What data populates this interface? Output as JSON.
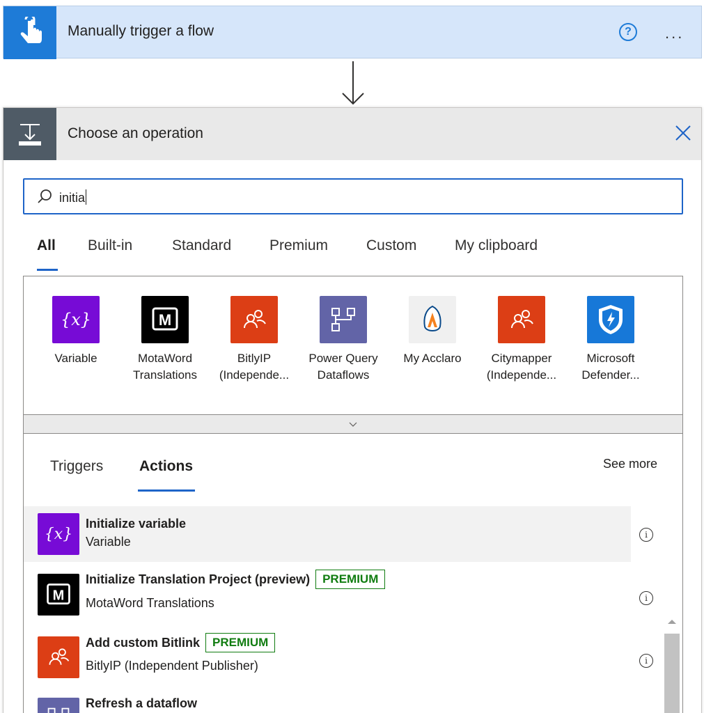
{
  "trigger": {
    "title": "Manually trigger a flow",
    "help_icon": "?",
    "more_icon": "..."
  },
  "panel": {
    "title": "Choose an operation"
  },
  "search": {
    "value": "initia"
  },
  "tabs": [
    "All",
    "Built-in",
    "Standard",
    "Premium",
    "Custom",
    "My clipboard"
  ],
  "connectors": [
    {
      "line1": "Variable",
      "line2": "",
      "icon": "variable-icon",
      "color": "#770bd6"
    },
    {
      "line1": "MotaWord",
      "line2": "Translations",
      "icon": "motaword-icon",
      "color": "#000000"
    },
    {
      "line1": "BitlyIP",
      "line2": "(Independe...",
      "icon": "bitlyip-icon",
      "color": "#dc3e15"
    },
    {
      "line1": "Power Query",
      "line2": "Dataflows",
      "icon": "dataflow-icon",
      "color": "#6264a7"
    },
    {
      "line1": "My Acclaro",
      "line2": "",
      "icon": "acclaro-icon",
      "color": "#f0f0f0"
    },
    {
      "line1": "Citymapper",
      "line2": "(Independe...",
      "icon": "citymapper-icon",
      "color": "#dc3e15"
    },
    {
      "line1": "Microsoft",
      "line2": "Defender...",
      "icon": "defender-icon",
      "color": "#1778d8"
    }
  ],
  "results": {
    "tabs": [
      "Triggers",
      "Actions"
    ],
    "see_more": "See more",
    "rows": [
      {
        "title": "Initialize variable",
        "subtitle": "Variable",
        "badge": ""
      },
      {
        "title": "Initialize Translation Project (preview)",
        "subtitle": "MotaWord Translations",
        "badge": "PREMIUM"
      },
      {
        "title": "Add custom Bitlink",
        "subtitle": "BitlyIP (Independent Publisher)",
        "badge": "PREMIUM"
      },
      {
        "title": "Refresh a dataflow",
        "subtitle": "",
        "badge": ""
      }
    ],
    "info_icon": "i"
  },
  "colors": {
    "accent": "#1e64c8",
    "premium": "#107c10",
    "trigger_bg": "#d6e6fa"
  }
}
